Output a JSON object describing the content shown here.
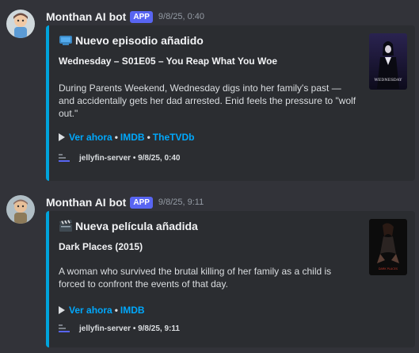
{
  "messages": [
    {
      "username": "Monthan AI bot",
      "badge": "APP",
      "timestamp": "9/8/25, 0:40",
      "embed": {
        "title_icon": "tv-icon",
        "title": "Nuevo episodio añadido",
        "subtitle": "Wednesday – S01E05 – You Reap What You Woe",
        "description": "During Parents Weekend, Wednesday digs into her family's past — and accidentally gets her dad arrested. Enid feels the pressure to \"wolf out.\"",
        "links": [
          "Ver ahora",
          "IMDB",
          "TheTVDb"
        ],
        "link_separator": "•",
        "footer": "jellyfin-server • 9/8/25, 0:40",
        "thumbnail_text": "WEDNESDAY",
        "accent_color": "#00a4dc"
      }
    },
    {
      "username": "Monthan AI bot",
      "badge": "APP",
      "timestamp": "9/8/25, 9:11",
      "embed": {
        "title_icon": "clapperboard-icon",
        "title": "Nueva película añadida",
        "subtitle": "Dark Places (2015)",
        "description": "A woman who survived the brutal killing of her family as a child is forced to confront the events of that day.",
        "links": [
          "Ver ahora",
          "IMDB"
        ],
        "link_separator": "•",
        "footer": "jellyfin-server • 9/8/25, 9:11",
        "thumbnail_text": "DARK PLACES",
        "accent_color": "#00a4dc"
      }
    }
  ]
}
